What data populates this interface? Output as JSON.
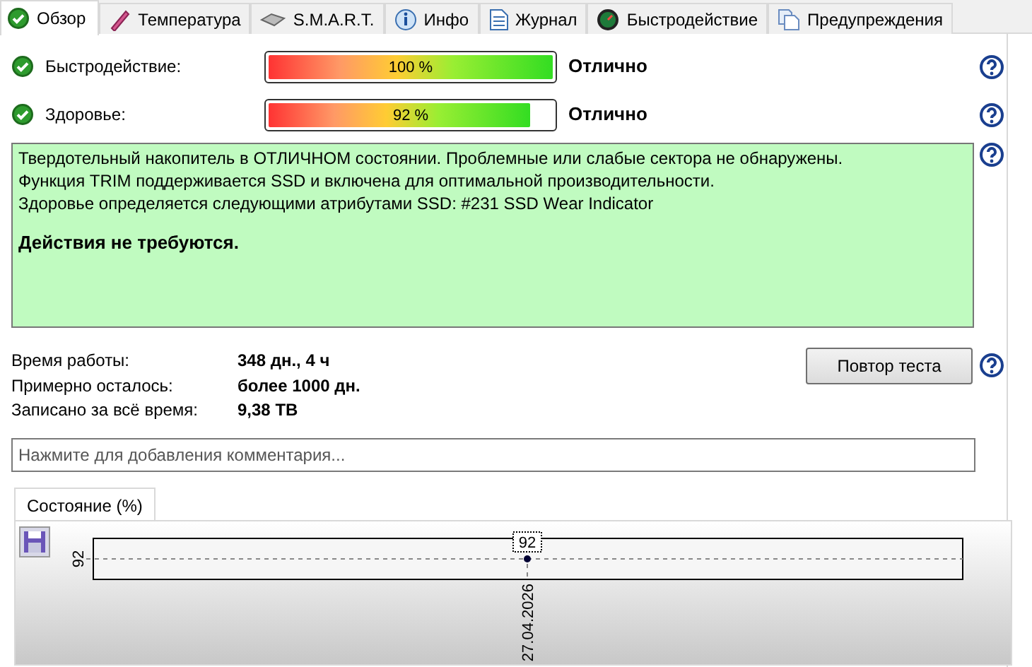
{
  "tabs": [
    {
      "label": "Обзор",
      "kind": "check",
      "selected": true
    },
    {
      "label": "Температура",
      "kind": "stick",
      "selected": false
    },
    {
      "label": "S.M.A.R.T.",
      "kind": "drive",
      "selected": false
    },
    {
      "label": "Инфо",
      "kind": "info",
      "selected": false
    },
    {
      "label": "Журнал",
      "kind": "document",
      "selected": false
    },
    {
      "label": "Быстродействие",
      "kind": "gauge",
      "selected": false
    },
    {
      "label": "Предупреждения",
      "kind": "documents",
      "selected": false
    }
  ],
  "meters": [
    {
      "label": "Быстродействие:",
      "level": 1.0,
      "reading": "100 %",
      "rating": "Отлично"
    },
    {
      "label": "Здоровье:",
      "level": 0.92,
      "reading": "92 %",
      "rating": "Отлично"
    }
  ],
  "summary": {
    "lines": [
      "Твердотельный накопитель в ОТЛИЧНОМ состоянии. Проблемные или слабые сектора не обнаружены.",
      "Функция TRIM поддерживается SSD и включена для оптимальной производительности.",
      "Здоровье определяется следующими атрибутами SSD: #231 SSD Wear Indicator"
    ],
    "action": "Действия не требуются."
  },
  "stats": [
    {
      "label": "Время работы:",
      "value": "348 дн., 4 ч"
    },
    {
      "label": "Примерно осталось:",
      "value": "более 1000 дн."
    },
    {
      "label": "Записано за всё время:",
      "value": "9,38 TB"
    }
  ],
  "retest_button": "Повтор теста",
  "comment": {
    "placeholder": "Нажмите для добавления комментария..."
  },
  "chart_tab": {
    "label": "Состояние (%)",
    "selected": true
  },
  "chart": {
    "y_label": "92",
    "value_label": "92",
    "date_label": "27.04.2026"
  }
}
